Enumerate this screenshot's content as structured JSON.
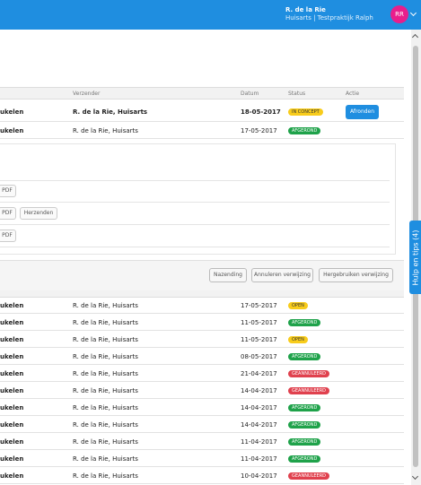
{
  "user": {
    "name": "R. de la Rie",
    "org": "Huisarts | Testpraktijk Ralph",
    "initials": "RR"
  },
  "help_tab": "Hulp en tips (4)",
  "table_headers": {
    "verzender": "Verzender",
    "datum": "Datum",
    "status": "Status",
    "actie": "Actie"
  },
  "top_rows": [
    {
      "subject": "ukelen",
      "sender": "R. de la Rie, Huisarts",
      "date": "18-05-2017",
      "status": "IN CONCEPT",
      "action": "Afronden"
    },
    {
      "subject": "ukelen",
      "sender": "R. de la Rie, Huisarts",
      "date": "17-05-2017",
      "status": "AFGEROND"
    }
  ],
  "detail_buttons": {
    "pdf1": "PDF",
    "pdf2": "PDF",
    "herzenden": "Herzenden",
    "pdf3": "PDF"
  },
  "actions": {
    "nazending": "Nazending",
    "annuleren": "Annuleren verwijzing",
    "hergebruiken": "Hergebruiken verwijzing"
  },
  "rows": [
    {
      "subject": "ukelen",
      "sender": "R. de la Rie, Huisarts",
      "date": "17-05-2017",
      "status": "OPEN"
    },
    {
      "subject": "ukelen",
      "sender": "R. de la Rie, Huisarts",
      "date": "11-05-2017",
      "status": "AFGEROND"
    },
    {
      "subject": "ukelen",
      "sender": "R. de la Rie, Huisarts",
      "date": "11-05-2017",
      "status": "OPEN"
    },
    {
      "subject": "ukelen",
      "sender": "R. de la Rie, Huisarts",
      "date": "08-05-2017",
      "status": "AFGEROND"
    },
    {
      "subject": "ukelen",
      "sender": "R. de la Rie, Huisarts",
      "date": "21-04-2017",
      "status": "GEANNULEERD"
    },
    {
      "subject": "ukelen",
      "sender": "R. de la Rie, Huisarts",
      "date": "14-04-2017",
      "status": "GEANNULEERD"
    },
    {
      "subject": "ukelen",
      "sender": "R. de la Rie, Huisarts",
      "date": "14-04-2017",
      "status": "AFGEROND"
    },
    {
      "subject": "ukelen",
      "sender": "R. de la Rie, Huisarts",
      "date": "14-04-2017",
      "status": "AFGEROND"
    },
    {
      "subject": "ukelen",
      "sender": "R. de la Rie, Huisarts",
      "date": "11-04-2017",
      "status": "AFGEROND"
    },
    {
      "subject": "ukelen",
      "sender": "R. de la Rie, Huisarts",
      "date": "11-04-2017",
      "status": "AFGEROND"
    },
    {
      "subject": "ukelen",
      "sender": "R. de la Rie, Huisarts",
      "date": "10-04-2017",
      "status": "GEANNULEERD"
    }
  ],
  "colors": {
    "brand": "#1f8ee0",
    "avatar": "#e91e8c",
    "status_concept": "#f8cc1b",
    "status_afgerond": "#1fa24a",
    "status_geannuleerd": "#e0414e"
  }
}
